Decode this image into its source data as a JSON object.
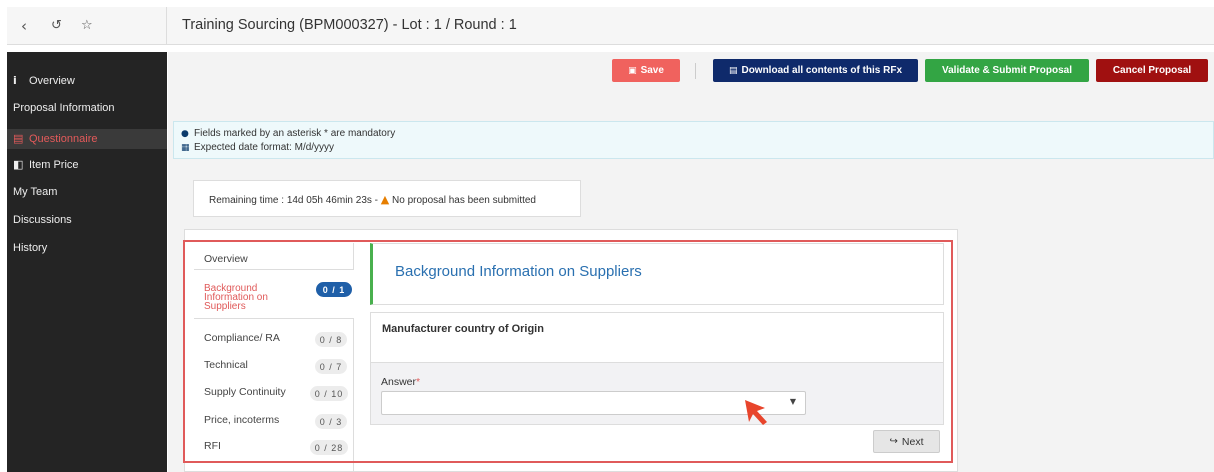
{
  "topbar": {
    "title": "Training Sourcing (BPM000327) - Lot : 1 / Round : 1",
    "icons": [
      "chevron-left-icon",
      "history-icon",
      "star-icon"
    ]
  },
  "sidebar": {
    "items": [
      {
        "label": "Overview",
        "icon": "info-icon"
      },
      {
        "label": "Proposal Information",
        "icon": ""
      },
      {
        "label": "Questionnaire",
        "icon": "list-icon",
        "active": true
      },
      {
        "label": "Item Price",
        "icon": "book-icon"
      },
      {
        "label": "My Team",
        "icon": ""
      },
      {
        "label": "Discussions",
        "icon": ""
      },
      {
        "label": "History",
        "icon": ""
      }
    ]
  },
  "toolbar": {
    "save_label": "Save",
    "download_label": "Download all contents of this RFx",
    "validate_label": "Validate & Submit Proposal",
    "cancel_label": "Cancel Proposal",
    "colors": {
      "save": "#f0625e",
      "download": "#0f2a6b",
      "validate": "#33a544",
      "cancel": "#a01010"
    }
  },
  "info": {
    "mandatory_note": "Fields marked by an asterisk * are mandatory",
    "date_format_note": "Expected date format: M/d/yyyy"
  },
  "status": {
    "remaining_label": "Remaining time :",
    "remaining_value": "14d 05h 46min 23s -",
    "warning_text": "No proposal has been submitted"
  },
  "questionnaire": {
    "sections": [
      {
        "label": "Overview",
        "count": ""
      },
      {
        "label": "Background Information on Suppliers",
        "count": "0 / 1",
        "active": true
      },
      {
        "label": "Compliance/ RA",
        "count": "0 / 8"
      },
      {
        "label": "Technical",
        "count": "0 / 7"
      },
      {
        "label": "Supply Continuity",
        "count": "0 / 10"
      },
      {
        "label": "Price, incoterms",
        "count": "0 / 3"
      },
      {
        "label": "RFI",
        "count": "0 / 28"
      }
    ],
    "section_title": "Background Information on Suppliers",
    "question": "Manufacturer country of Origin",
    "answer_label": "Answer",
    "required_marker": "*",
    "answer_value": "",
    "next_label": "Next"
  }
}
